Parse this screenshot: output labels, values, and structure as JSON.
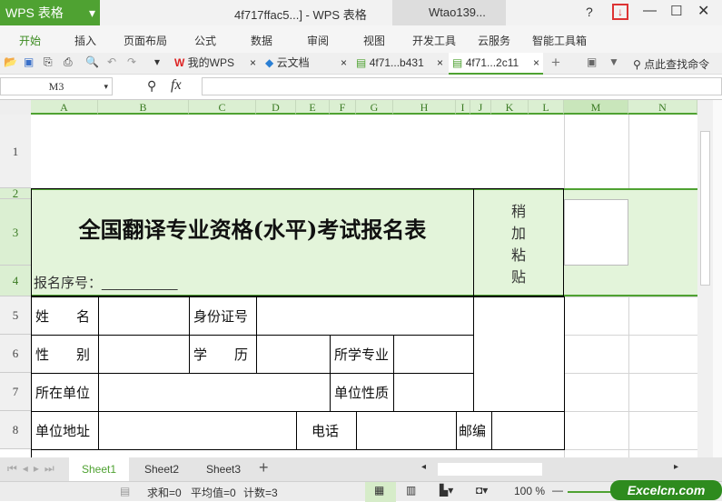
{
  "title_bar": {
    "app": "WPS 表格",
    "doc_title": "4f717ffac5...] - WPS 表格",
    "user": "Wtao139...",
    "help": "?"
  },
  "ribbon_tabs": [
    "开始",
    "插入",
    "页面布局",
    "公式",
    "数据",
    "审阅",
    "视图",
    "开发工具",
    "云服务",
    "智能工具箱"
  ],
  "doc_tabs": [
    {
      "label": "我的WPS"
    },
    {
      "label": "云文档"
    },
    {
      "label": "4f71...b431"
    },
    {
      "label": "4f71...2c11",
      "active": true
    }
  ],
  "search_cmd": "点此查找命令",
  "formula_bar": {
    "name_box": "M3",
    "fx": "fx",
    "value": ""
  },
  "columns": [
    "A",
    "B",
    "C",
    "D",
    "E",
    "F",
    "G",
    "H",
    "I",
    "J",
    "K",
    "L",
    "M",
    "N"
  ],
  "rows": [
    "1",
    "2",
    "3",
    "4",
    "5",
    "6",
    "7",
    "8"
  ],
  "form": {
    "title": "全国翻译专业资格(水平)考试报名表",
    "serial_label": "报名序号：__________",
    "photo": [
      "稍",
      "加",
      "粘",
      "贴"
    ],
    "name": "姓　　名",
    "id_no": "身份证号",
    "gender": "性　　别",
    "education": "学　　历",
    "major": "所学专业",
    "employer": "所在单位",
    "employer_type": "单位性质",
    "address": "单位地址",
    "phone": "电话",
    "postcode": "邮编"
  },
  "sheets": [
    "Sheet1",
    "Sheet2",
    "Sheet3"
  ],
  "status": {
    "sum": "求和=0",
    "avg": "平均值=0",
    "count": "计数=3",
    "zoom": "100 %"
  },
  "watermark": "Excelcn.com",
  "colors": {
    "accent": "#4fa232",
    "selection": "#e3f4da"
  }
}
